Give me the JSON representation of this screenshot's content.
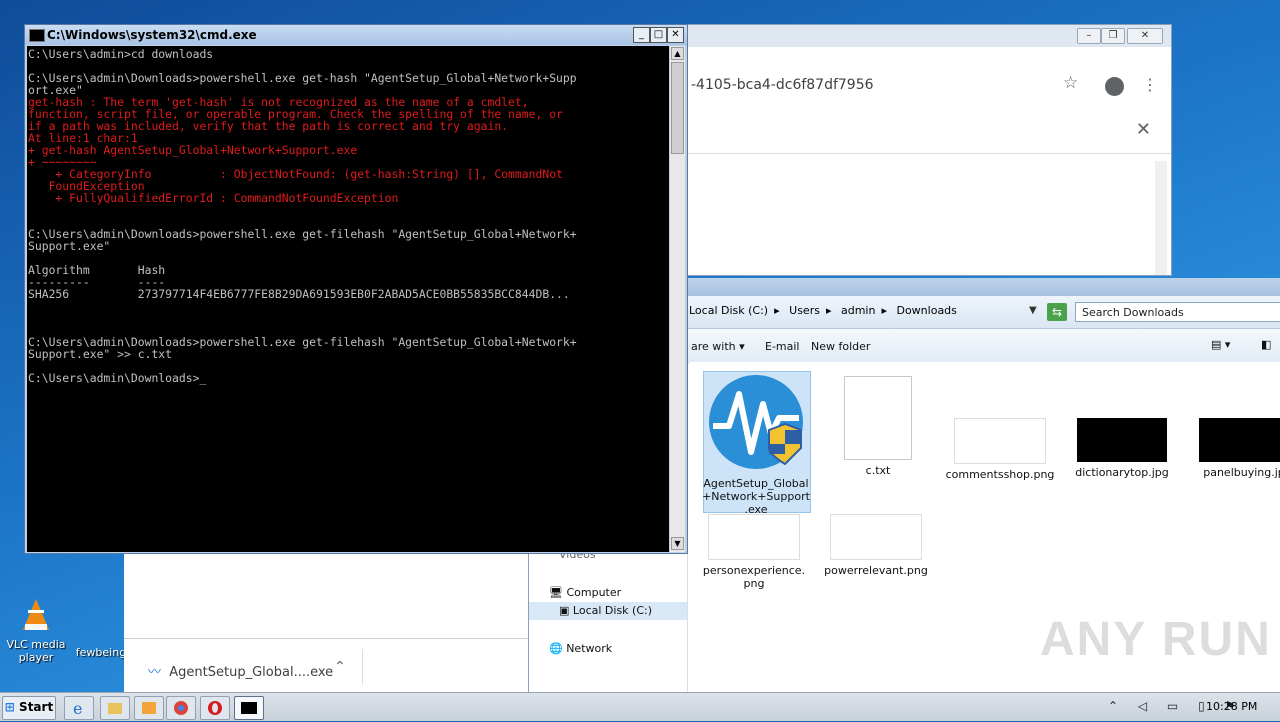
{
  "desktop": {
    "icons": [
      {
        "label": "VLC media player"
      },
      {
        "label": "fewbeing"
      }
    ]
  },
  "cmd": {
    "title": "C:\\Windows\\system32\\cmd.exe",
    "lines": [
      {
        "text": "C:\\Users\\admin>cd downloads",
        "type": "normal"
      },
      {
        "text": "",
        "type": "normal"
      },
      {
        "text": "C:\\Users\\admin\\Downloads>powershell.exe get-hash \"AgentSetup_Global+Network+Supp",
        "type": "normal"
      },
      {
        "text": "ort.exe\"",
        "type": "normal"
      },
      {
        "text": "get-hash : The term 'get-hash' is not recognized as the name of a cmdlet,",
        "type": "error"
      },
      {
        "text": "function, script file, or operable program. Check the spelling of the name, or",
        "type": "error"
      },
      {
        "text": "if a path was included, verify that the path is correct and try again.",
        "type": "error"
      },
      {
        "text": "At line:1 char:1",
        "type": "error"
      },
      {
        "text": "+ get-hash AgentSetup_Global+Network+Support.exe",
        "type": "error"
      },
      {
        "text": "+ ~~~~~~~~",
        "type": "error"
      },
      {
        "text": "    + CategoryInfo          : ObjectNotFound: (get-hash:String) [], CommandNot",
        "type": "error"
      },
      {
        "text": "   FoundException",
        "type": "error"
      },
      {
        "text": "    + FullyQualifiedErrorId : CommandNotFoundException",
        "type": "error"
      },
      {
        "text": "",
        "type": "normal"
      },
      {
        "text": "",
        "type": "normal"
      },
      {
        "text": "C:\\Users\\admin\\Downloads>powershell.exe get-filehash \"AgentSetup_Global+Network+",
        "type": "normal"
      },
      {
        "text": "Support.exe\"",
        "type": "normal"
      },
      {
        "text": "",
        "type": "normal"
      },
      {
        "text": "Algorithm       Hash",
        "type": "normal"
      },
      {
        "text": "---------       ----",
        "type": "normal"
      },
      {
        "text": "SHA256          273797714F4EB6777FE8B29DA691593EB0F2ABAD5ACE0BB55835BCC844DB...",
        "type": "normal"
      },
      {
        "text": "",
        "type": "normal"
      },
      {
        "text": "",
        "type": "normal"
      },
      {
        "text": "",
        "type": "normal"
      },
      {
        "text": "C:\\Users\\admin\\Downloads>powershell.exe get-filehash \"AgentSetup_Global+Network+",
        "type": "normal"
      },
      {
        "text": "Support.exe\" >> c.txt",
        "type": "normal"
      },
      {
        "text": "",
        "type": "normal"
      },
      {
        "text": "C:\\Users\\admin\\Downloads>_",
        "type": "normal"
      }
    ]
  },
  "chrome": {
    "url_fragment": "-4105-bca4-dc6f87df7956",
    "download": {
      "filename": "AgentSetup_Global....exe"
    }
  },
  "explorer": {
    "breadcrumb": [
      "Local Disk (C:)",
      "Users",
      "admin",
      "Downloads"
    ],
    "search_placeholder": "Search Downloads",
    "commands": {
      "share": "are with",
      "email": "E-mail",
      "new_folder": "New folder"
    },
    "nav": {
      "computer": "Computer",
      "local_disk": "Local Disk (C:)",
      "network": "Network",
      "videos": "Videos"
    },
    "files": [
      {
        "name": "AgentSetup_Global+Network+Support.exe",
        "line1": "AgentSetup_Global",
        "line2": "+Network+Support",
        "line3": ".exe"
      },
      {
        "name": "c.txt"
      },
      {
        "name": "commentsshop.png"
      },
      {
        "name": "dictionarytop.jpg"
      },
      {
        "name": "panelbuying.jpg",
        "display": "panelbuying.jp"
      },
      {
        "name": "personexperience.png",
        "line1": "personexperience.",
        "line2": "png"
      },
      {
        "name": "powerrelevant.png"
      }
    ]
  },
  "taskbar": {
    "start_label": "Start",
    "clock": "10:28 PM"
  },
  "watermark": "ANY RUN"
}
